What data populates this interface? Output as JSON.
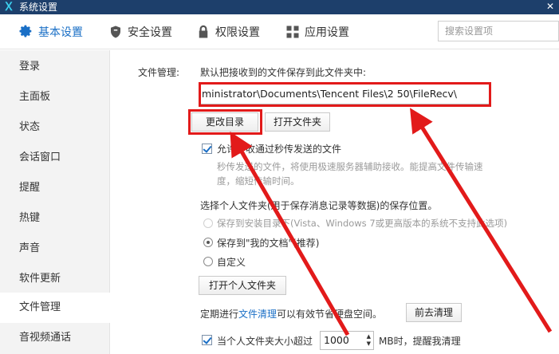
{
  "window": {
    "title": "系统设置"
  },
  "tabs": [
    {
      "label": "基本设置",
      "icon": "gear-icon",
      "active": true
    },
    {
      "label": "安全设置",
      "icon": "shield-icon",
      "active": false
    },
    {
      "label": "权限设置",
      "icon": "lock-icon",
      "active": false
    },
    {
      "label": "应用设置",
      "icon": "apps-grid-icon",
      "active": false
    }
  ],
  "search": {
    "placeholder": "搜索设置项"
  },
  "sidebar": {
    "items": [
      {
        "label": "登录"
      },
      {
        "label": "主面板"
      },
      {
        "label": "状态"
      },
      {
        "label": "会话窗口"
      },
      {
        "label": "提醒"
      },
      {
        "label": "热键"
      },
      {
        "label": "声音"
      },
      {
        "label": "软件更新"
      },
      {
        "label": "文件管理",
        "active": true
      },
      {
        "label": "音视频通话"
      }
    ]
  },
  "file_mgmt": {
    "section_label": "文件管理:",
    "save_desc": "默认把接收到的文件保存到此文件夹中:",
    "path_value": "ministrator\\Documents\\Tencent Files\\2          50\\FileRecv\\",
    "change_dir_button": "更改目录",
    "open_folder_button": "打开文件夹",
    "allow_offline": {
      "label": "允许接收通过秒传发送的文件",
      "checked": true
    },
    "offline_desc_line1": "秒传发送的文件，将使用极速服务器辅助接收。能提高文件传输速",
    "offline_desc_line2": "度，缩短传输时间。",
    "personal_folder_desc": "选择个人文件夹(用于保存消息记录等数据)的保存位置。",
    "radio_options": [
      {
        "label": "保存到安装目录下(Vista、Windows 7或更高版本的系统不支持此选项)",
        "disabled": true,
        "selected": false
      },
      {
        "label": "保存到\"我的文档\"(推荐)",
        "disabled": false,
        "selected": true
      },
      {
        "label": "自定义",
        "disabled": false,
        "selected": false
      }
    ],
    "open_personal_button": "打开个人文件夹",
    "cleanup_prefix": "定期进行",
    "cleanup_link": "文件清理",
    "cleanup_suffix": "可以有效节省硬盘空间。",
    "cleanup_button": "前去清理",
    "size_alert": {
      "prefix": "当个人文件夹大小超过",
      "value": "1000",
      "suffix": "MB时，提醒我清理",
      "checked": true
    }
  },
  "annotation_color": "#e21a1a"
}
